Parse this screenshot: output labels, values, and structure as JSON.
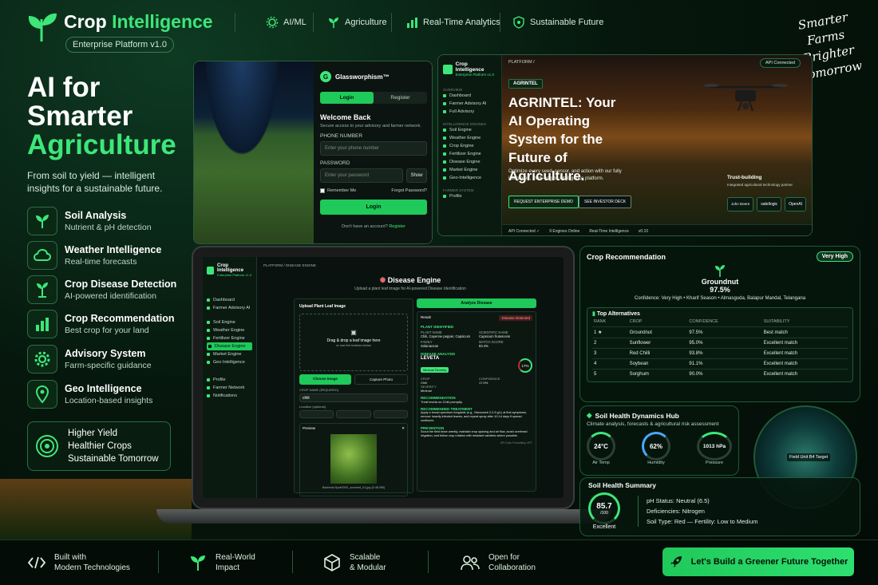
{
  "brand": {
    "title_a": "Crop ",
    "title_b": "Intelligence",
    "badge": "Enterprise Platform v1.0"
  },
  "topnav": [
    "AI/ML",
    "Agriculture",
    "Real-Time Analytics",
    "Sustainable Future"
  ],
  "slogan": [
    "Smarter",
    "Farms",
    "Brighter",
    "Tomorrow"
  ],
  "hero": {
    "line1": "AI for",
    "line2": "Smarter",
    "line3": "Agriculture",
    "sub": "From soil to yield — intelligent insights for a sustainable future."
  },
  "features": [
    {
      "title": "Soil Analysis",
      "sub": "Nutrient & pH detection",
      "icon": "sprout-icon"
    },
    {
      "title": "Weather Intelligence",
      "sub": "Real-time forecasts",
      "icon": "cloud-icon"
    },
    {
      "title": "Crop Disease Detection",
      "sub": "AI-powered identification",
      "icon": "plant-icon"
    },
    {
      "title": "Crop Recommendation",
      "sub": "Best crop for your land",
      "icon": "bar-chart-icon"
    },
    {
      "title": "Advisory System",
      "sub": "Farm-specific guidance",
      "icon": "gear-icon"
    },
    {
      "title": "Geo Intelligence",
      "sub": "Location-based insights",
      "icon": "pin-icon"
    }
  ],
  "yield": [
    "Higher Yield",
    "Healthier Crops",
    "Sustainable Tomorrow"
  ],
  "login": {
    "brand": "Glassworphism™",
    "tab_login": "Login",
    "tab_register": "Register",
    "welcome": "Welcome Back",
    "welcome_sub": "Secure access to your advisory and farmer network.",
    "phone_label": "PHONE NUMBER",
    "phone_placeholder": "Enter your phone number",
    "password_label": "PASSWORD",
    "password_placeholder": "Enter your password",
    "show": "Show",
    "remember": "Remember Me",
    "forgot": "Forgot Password?",
    "submit": "Login",
    "no_account": "Don't have an account?",
    "register_link": "Register"
  },
  "dash": {
    "brand": "Crop Intelligence",
    "brand_sub": "Enterprise Platform v1.0",
    "crumb": "PLATFORM /",
    "api": "API Connected",
    "badge": "AGRINTEL",
    "headline": "AGRINTEL: Your AI Operating System for the Future of Agriculture.",
    "body": "Optimize every seed, sensor, and action with our fully integrated, multi-engine intelligence platform.",
    "btn_demo": "REQUEST ENTERPRISE DEMO",
    "btn_deck": "SEE INVESTOR DECK",
    "trust": "Trust-building",
    "trust_sub": "Integrated agricultural technology partner",
    "side_overview": "OVERVIEW",
    "side_intel": "INTELLIGENCE ENGINES",
    "side_farmer": "FARMER SYSTEM",
    "side_items": [
      "Dashboard",
      "Farmer Advisory AI",
      "Full Advisory"
    ],
    "engines": [
      "Soil Engine",
      "Weather Engine",
      "Crop Engine",
      "Fertilizer Engine",
      "Disease Engine",
      "Market Engine",
      "Geo-Intelligence"
    ],
    "farmer_items": [
      "Profile"
    ],
    "status": [
      "API Connected ✓",
      "9 Engines Online",
      "Real-Time Intelligence",
      "v0.10"
    ],
    "partners": [
      "John Deere",
      "sateliogic",
      "OpenAI"
    ]
  },
  "laptop": {
    "brand": "Crop Intelligence",
    "brand_sub": "Enterprise Platform v1.0",
    "crumb": "PLATFORM / DISEASE ENGINE",
    "title": "Disease Engine",
    "subtitle": "Upload a plant leaf image for AI-powered Disease Identification",
    "side": [
      "Dashboard",
      "Farmer Advisory AI",
      "Soil Engine",
      "Weather Engine",
      "Fertilizer Engine",
      "Disease Engine",
      "Market Engine",
      "Geo Intelligence",
      "Profile",
      "Farmer Network",
      "Notifications"
    ],
    "upload_label": "Upload Plant Leaf Image",
    "drop": "Drag & drop a leaf image here",
    "drop_sub": "or use the buttons below",
    "choose": "Choose Image",
    "capture": "Capture Photo",
    "crop_label": "CROP NAME (REQUIRED)",
    "crop_value": "chili",
    "loc_label": "Location (optional)",
    "preview": "Preview",
    "file": "Bacterial Spot000X_zoomed_01.jpg (0.48 MB)",
    "analyze": "Analyze Disease",
    "result": "Result",
    "detected": "Disease Detected",
    "plant_id": "PLANT IDENTIFIED",
    "plant_name": "Chili, Cayenne pepper, Capsicum",
    "sci_label": "SCIENTIFIC NAME",
    "sci": "Capsicum frutescens",
    "family_label": "FAMILY",
    "family": "Solanaceae",
    "match_label": "MATCH SCORE",
    "match": "83.4%",
    "analysis": "DISEASE ANALYSIS",
    "disease": "LEVETA",
    "severity": "Minimal Severity",
    "confidence": "17%",
    "crop_l": "CROP",
    "crop_v": "Chili",
    "conf_l": "CONFIDENCE",
    "conf_v": "17.0%",
    "sev_l": "SEVERITY",
    "sev_v": "Minimal",
    "rec": "RECOMMENDATION",
    "rec_t": "Treat leveta on Chili promptly.",
    "treat": "RECOMMENDED TREATMENT",
    "treat_t": "Apply a broad-spectrum fungicide (e.g., Mancozeb 2-2.5 g/L) at first symptoms, remove heavily infected leaves, and repeat spray after 10-14 days if spread continues.",
    "prev": "PREVENTION",
    "prev_t": "Scout the field twice weekly, maintain crop spacing and air flow, avoid overhead irrigation, and follow crop rotation with resistant varieties where possible.",
    "api": "API Data Formatting: APT"
  },
  "croprec": {
    "title": "Crop Recommendation",
    "badge": "Very High",
    "crop": "Groundnut",
    "pct": "97.5%",
    "confidence_line": "Confidence: Very High • Kharif Season • Almasguda, Balapur Mandal, Telangana",
    "alt_title": "Top Alternatives",
    "headers": [
      "RANK",
      "CROP",
      "CONFIDENCE",
      "SUITABILITY"
    ],
    "rows": [
      [
        "1 ★",
        "Groundnut",
        "97.5%",
        "Best match"
      ],
      [
        "2",
        "Sunflower",
        "95.0%",
        "Excellent match"
      ],
      [
        "3",
        "Red Chilli",
        "93.8%",
        "Excellent match"
      ],
      [
        "4",
        "Soybean",
        "91.1%",
        "Excellent match"
      ],
      [
        "5",
        "Sorghum",
        "90.0%",
        "Excellent match"
      ]
    ]
  },
  "soilhub": {
    "title": "Soil Health Dynamics Hub",
    "sub": "Climate analysis, forecasts & agricultural risk assessment",
    "air_v": "24°C",
    "air_l": "Air Temp",
    "hum_v": "62%",
    "hum_l": "Humidity",
    "pres_v": "1013 hPa",
    "pres_l": "Pressure",
    "target": "Field Unit B4 Target"
  },
  "soilsum": {
    "title": "Soil Health Summary",
    "score": "85.7",
    "score_den": "/100",
    "score_label": "Excellent",
    "lines": [
      "pH Status: Neutral (6.5)",
      "Deficiencies: Nitrogen",
      "Soil Type: Red — Fertility: Low to Medium"
    ]
  },
  "bottom": [
    {
      "l1": "Built with",
      "l2": "Modern Technologies"
    },
    {
      "l1": "Real-World",
      "l2": "Impact"
    },
    {
      "l1": "Scalable",
      "l2": "& Modular"
    },
    {
      "l1": "Open for",
      "l2": "Collaboration"
    }
  ],
  "cta": "Let's Build a Greener Future Together",
  "colors": {
    "accent": "#3ee67a",
    "bg": "#06170d",
    "button": "#1fc95a"
  }
}
